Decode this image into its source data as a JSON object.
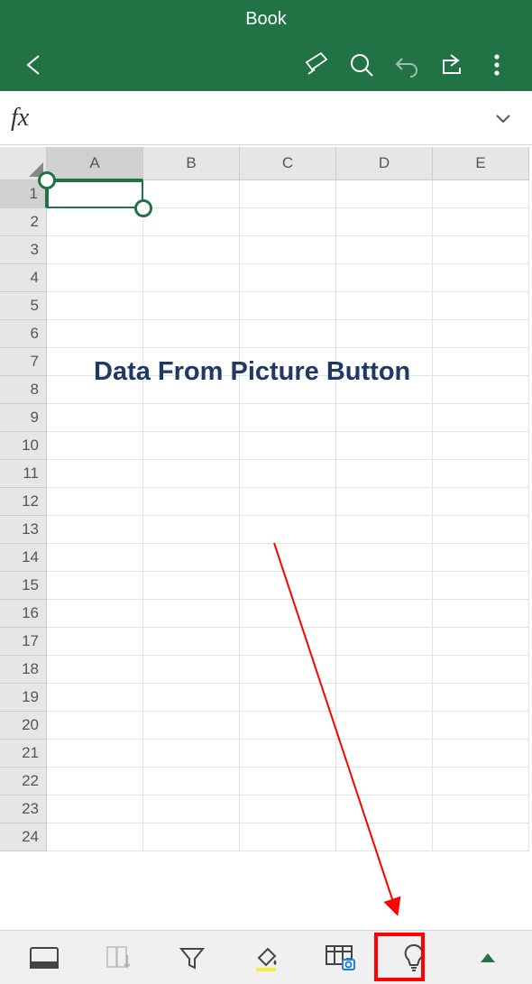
{
  "header": {
    "title": "Book"
  },
  "fx": {
    "symbol": "fx",
    "value": ""
  },
  "columns": [
    "A",
    "B",
    "C",
    "D",
    "E"
  ],
  "rows": [
    "1",
    "2",
    "3",
    "4",
    "5",
    "6",
    "7",
    "8",
    "9",
    "10",
    "11",
    "12",
    "13",
    "14",
    "15",
    "16",
    "17",
    "18",
    "19",
    "20",
    "21",
    "22",
    "23",
    "24"
  ],
  "selection": {
    "col": "A",
    "row": 1
  },
  "annotation": {
    "label": "Data From Picture Button"
  },
  "footer_icons": {
    "card_view": "card-view-icon",
    "sort": "sort-icon",
    "filter": "filter-icon",
    "fill": "fill-color-icon",
    "data_from_picture": "data-from-picture-icon",
    "ideas": "lightbulb-icon",
    "expand": "expand-up-icon"
  }
}
